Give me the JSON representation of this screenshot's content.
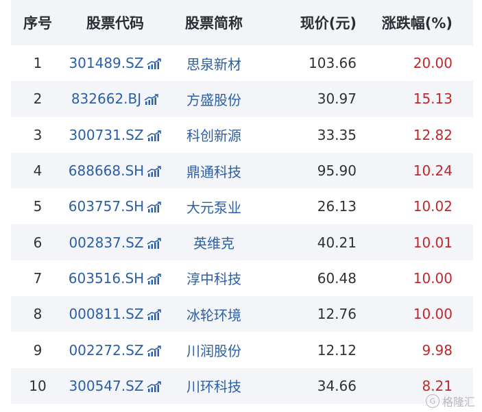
{
  "headers": {
    "idx": "序号",
    "code": "股票代码",
    "name": "股票简称",
    "price": "现价(元)",
    "chg": "涨跌幅(%)"
  },
  "rows": [
    {
      "idx": "1",
      "code": "301489.SZ",
      "name": "思泉新材",
      "price": "103.66",
      "chg": "20.00"
    },
    {
      "idx": "2",
      "code": "832662.BJ",
      "name": "方盛股份",
      "price": "30.97",
      "chg": "15.13"
    },
    {
      "idx": "3",
      "code": "300731.SZ",
      "name": "科创新源",
      "price": "33.35",
      "chg": "12.82"
    },
    {
      "idx": "4",
      "code": "688668.SH",
      "name": "鼎通科技",
      "price": "95.90",
      "chg": "10.24"
    },
    {
      "idx": "5",
      "code": "603757.SH",
      "name": "大元泵业",
      "price": "26.13",
      "chg": "10.02"
    },
    {
      "idx": "6",
      "code": "002837.SZ",
      "name": "英维克",
      "price": "40.21",
      "chg": "10.01"
    },
    {
      "idx": "7",
      "code": "603516.SH",
      "name": "淳中科技",
      "price": "60.48",
      "chg": "10.00"
    },
    {
      "idx": "8",
      "code": "000811.SZ",
      "name": "冰轮环境",
      "price": "12.76",
      "chg": "10.00"
    },
    {
      "idx": "9",
      "code": "002272.SZ",
      "name": "川润股份",
      "price": "12.12",
      "chg": "9.98"
    },
    {
      "idx": "10",
      "code": "300547.SZ",
      "name": "川环科技",
      "price": "34.66",
      "chg": "8.21"
    }
  ],
  "watermark": {
    "logo": "G",
    "text": "格隆汇"
  },
  "colors": {
    "link": "#2a5fa8",
    "up": "#c0262b",
    "stripe": "#f3f5f9"
  },
  "icons": {
    "row_chart": "trend-chart-icon"
  }
}
